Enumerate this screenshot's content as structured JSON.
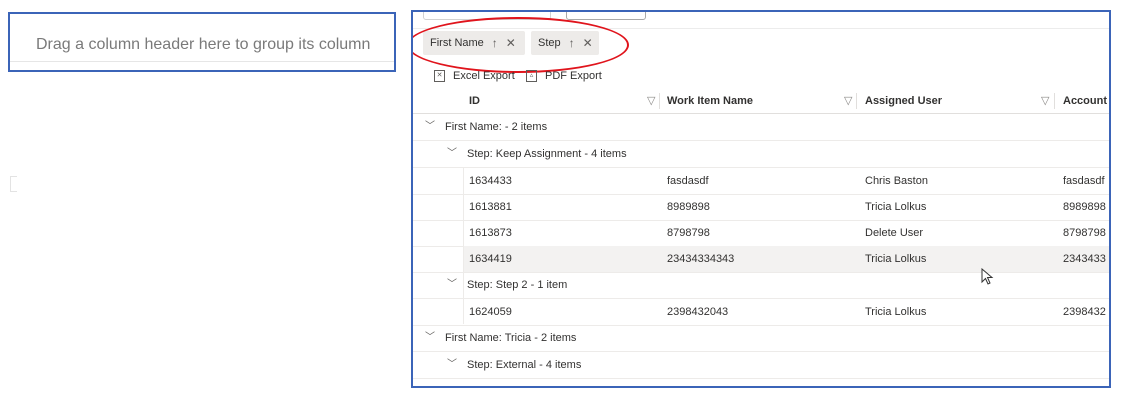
{
  "group_panel": {
    "hint": "Drag a column header here to group its column"
  },
  "group_chips": [
    {
      "label": "First Name",
      "sort_icon": "↑",
      "remove_icon": "✕"
    },
    {
      "label": "Step",
      "sort_icon": "↑",
      "remove_icon": "✕"
    }
  ],
  "toolbar": {
    "excel_label": "Excel Export",
    "pdf_label": "PDF Export"
  },
  "columns": [
    "ID",
    "Work Item Name",
    "Assigned User",
    "Account I"
  ],
  "groups": [
    {
      "label": "First Name: - 2 items",
      "subgroups": [
        {
          "label": "Step: Keep Assignment - 4 items",
          "rows": [
            [
              "1634433",
              "fasdasdf",
              "Chris Baston",
              "fasdasdf"
            ],
            [
              "1613881",
              "8989898",
              "Tricia Lolkus",
              "8989898"
            ],
            [
              "1613873",
              "8798798",
              "Delete User",
              "8798798"
            ],
            [
              "1634419",
              "23434334343",
              "Tricia Lolkus",
              "2343433"
            ]
          ]
        },
        {
          "label": "Step: Step 2 - 1 item",
          "rows": [
            [
              "1624059",
              "2398432043",
              "Tricia Lolkus",
              "2398432"
            ]
          ]
        }
      ]
    },
    {
      "label": "First Name: Tricia - 2 items",
      "subgroups": [
        {
          "label": "Step: External - 4 items",
          "rows": []
        }
      ]
    }
  ],
  "colors": {
    "panel_border": "#3b64b8",
    "annotation": "#e0141c",
    "chip_bg": "#edebe9"
  }
}
